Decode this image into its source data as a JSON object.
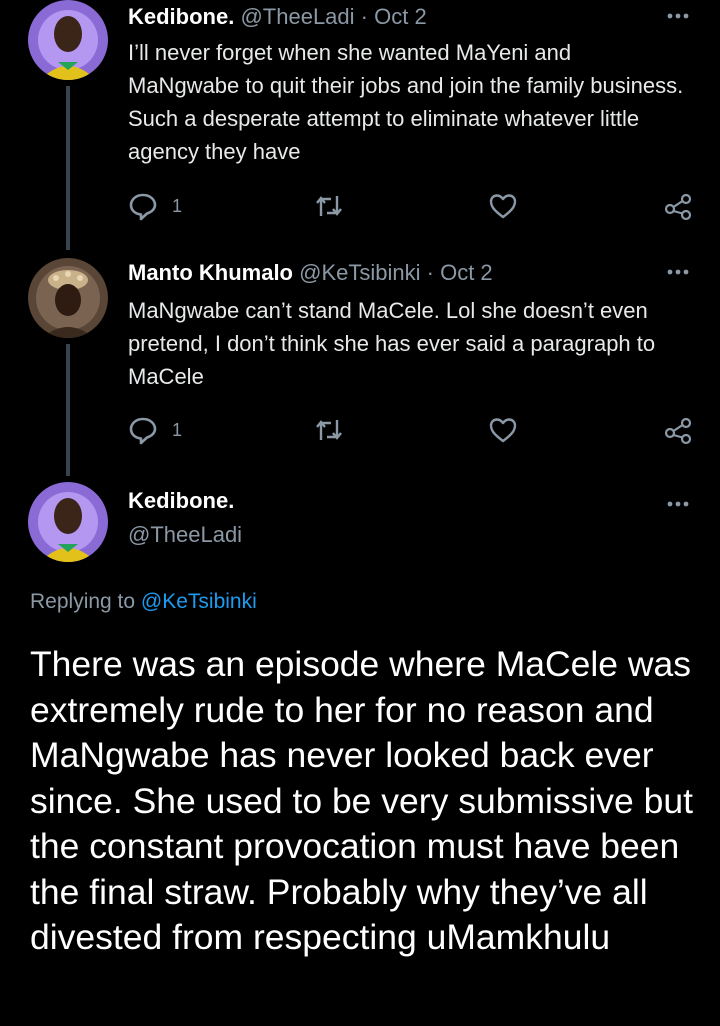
{
  "tweets": [
    {
      "name": "Kedibone.",
      "handle": "@TheeLadi",
      "sep": "·",
      "date": "Oct 2",
      "text": "I’ll never forget when she wanted MaYeni and MaNgwabe to quit their jobs and join the family business. Such a desperate attempt to eliminate whatever little agency they have",
      "reply_count": "1"
    },
    {
      "name": "Manto Khumalo",
      "handle": "@KeTsibinki",
      "sep": "·",
      "date": "Oct 2",
      "text": "MaNgwabe can’t stand MaCele. Lol she doesn’t even pretend, I don’t think she has ever said a paragraph to MaCele",
      "reply_count": "1"
    }
  ],
  "main_tweet": {
    "name": "Kedibone.",
    "handle": "@TheeLadi",
    "replying_prefix": "Replying to",
    "replying_to": "@KeTsibinki",
    "text": "There was an episode where MaCele was extremely rude to her for no reason and MaNgwabe has never looked back ever since. She used to be very submissive but the constant provocation must have been the final straw. Probably why they’ve all divested from respecting uMamkhulu"
  },
  "icons": {
    "reply": "reply-icon",
    "retweet": "retweet-icon",
    "like": "heart-icon",
    "share": "share-icon",
    "more": "more-icon"
  },
  "colors": {
    "background": "#000000",
    "secondary_text": "#8b98a5",
    "link": "#1d9bf0",
    "thread_line": "#38444d"
  }
}
